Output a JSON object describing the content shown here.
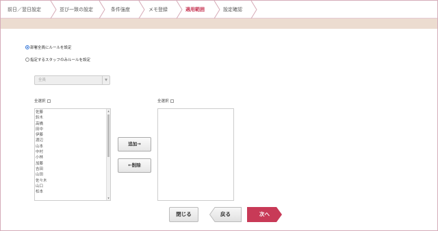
{
  "steps": [
    {
      "label": "前日／翌日設定",
      "active": false
    },
    {
      "label": "並び一致の設定",
      "active": false
    },
    {
      "label": "条件強度",
      "active": false
    },
    {
      "label": "メモ登録",
      "active": false
    },
    {
      "label": "適用範囲",
      "active": true
    },
    {
      "label": "設定確認",
      "active": false
    }
  ],
  "scope": {
    "option_all": "部署全員にルールを設定",
    "option_selected": "指定するスタッフのみルールを設定",
    "selected_option": "all"
  },
  "department_select": {
    "value": "全員"
  },
  "left_list": {
    "select_all_label": "全選択",
    "items": [
      "佐藤",
      "鈴木",
      "高橋",
      "田中",
      "伊藤",
      "渡辺",
      "山本",
      "中村",
      "小林",
      "加藤",
      "吉田",
      "山田",
      "佐々木",
      "山口",
      "松本"
    ]
  },
  "right_list": {
    "select_all_label": "全選択",
    "items": []
  },
  "actions": {
    "add_label": "追加→",
    "remove_label": "←削除"
  },
  "footer": {
    "close_label": "閉じる",
    "back_label": "戻る",
    "next_label": "次へ"
  },
  "colors": {
    "accent": "#c83a57",
    "band": "#ecdcd0",
    "border": "#d4aab8"
  }
}
